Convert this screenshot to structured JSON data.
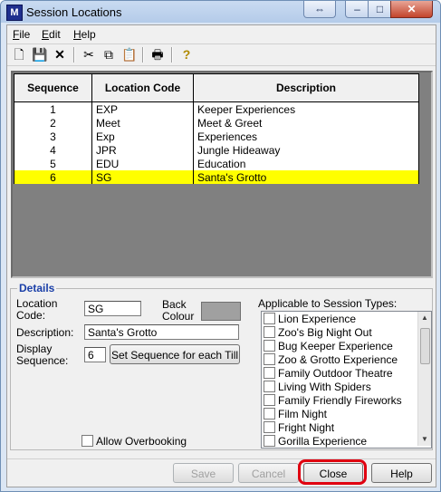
{
  "window": {
    "title": "Session Locations",
    "app_icon_text": "M"
  },
  "titlebar_buttons": {
    "restore": "⇔",
    "minimize": "–",
    "maximize": "□",
    "close": "✕"
  },
  "menu": [
    {
      "label": "File",
      "accel": "F"
    },
    {
      "label": "Edit",
      "accel": "E"
    },
    {
      "label": "Help",
      "accel": "H"
    }
  ],
  "toolbar": {
    "icons": [
      "new-icon",
      "save-icon",
      "delete-icon",
      "cut-icon",
      "copy-icon",
      "paste-icon",
      "print-icon",
      "help-icon"
    ],
    "glyphs": {
      "new": "🗋",
      "save": "💾",
      "delete": "✕",
      "cut": "✂",
      "copy": "⧉",
      "paste": "📋",
      "print": "🖶",
      "help": "?"
    }
  },
  "grid": {
    "columns": [
      "Sequence",
      "Location Code",
      "Description"
    ],
    "rows": [
      {
        "sequence": "1",
        "code": "EXP",
        "description": "Keeper Experiences"
      },
      {
        "sequence": "2",
        "code": "Meet",
        "description": "Meet & Greet"
      },
      {
        "sequence": "3",
        "code": "Exp",
        "description": "Experiences"
      },
      {
        "sequence": "4",
        "code": "JPR",
        "description": "Jungle Hideaway"
      },
      {
        "sequence": "5",
        "code": "EDU",
        "description": "Education"
      },
      {
        "sequence": "6",
        "code": "SG",
        "description": "Santa's Grotto"
      }
    ],
    "selected_row": 6,
    "highlight_color": "#ffff00"
  },
  "details": {
    "legend": "Details",
    "location_code_label": "Location Code:",
    "location_code_value": "SG",
    "back_colour_label": "Back Colour",
    "back_colour_value": "#a0a0a0",
    "description_label": "Description:",
    "description_value": "Santa's Grotto",
    "display_sequence_label": "Display Sequence:",
    "display_sequence_value": "6",
    "set_sequence_button": "Set Sequence for each Till",
    "allow_overbooking_label": "Allow Overbooking",
    "allow_overbooking_checked": false,
    "session_types_label": "Applicable to Session Types:",
    "session_types": [
      "Lion Experience",
      "Zoo's Big Night Out",
      "Bug Keeper Experience",
      "Zoo & Grotto Experience",
      "Family Outdoor Theatre",
      "Living With Spiders",
      "Family Friendly Fireworks",
      "Film Night",
      "Fright Night",
      "Gorilla Experience"
    ]
  },
  "buttons": {
    "save": "Save",
    "cancel": "Cancel",
    "close": "Close",
    "help": "Help"
  },
  "highlight_color": "#e00010"
}
